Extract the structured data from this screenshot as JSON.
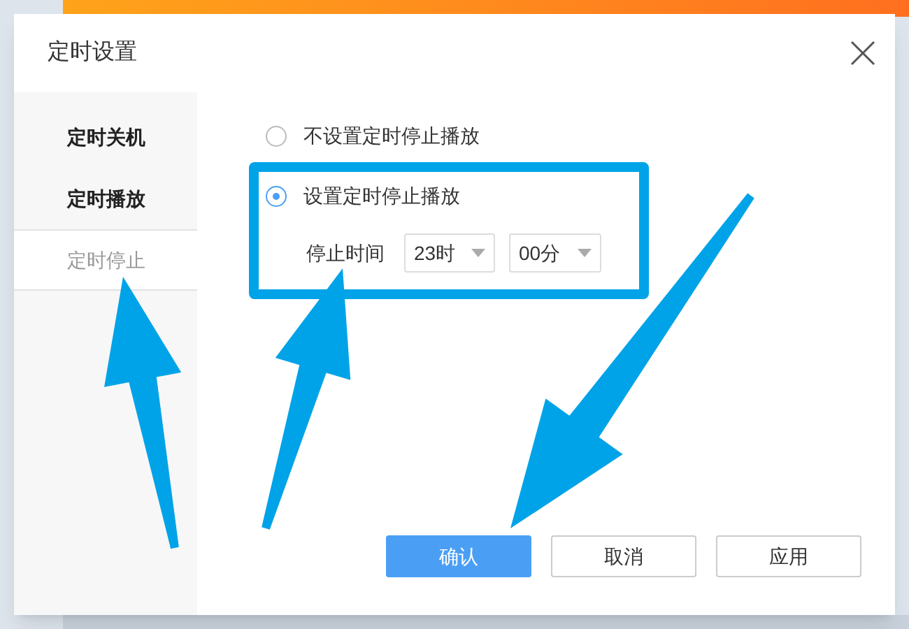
{
  "window": {
    "title": "定时设置"
  },
  "sidebar": {
    "items": [
      {
        "label": "定时关机",
        "selected": false
      },
      {
        "label": "定时播放",
        "selected": false
      },
      {
        "label": "定时停止",
        "selected": true
      }
    ]
  },
  "options": [
    {
      "label": "不设置定时停止播放",
      "selected": false
    },
    {
      "label": "设置定时停止播放",
      "selected": true
    }
  ],
  "stop_time": {
    "label": "停止时间",
    "hour": "23时",
    "minute": "00分"
  },
  "buttons": [
    {
      "label": "确认",
      "kind": "primary"
    },
    {
      "label": "取消",
      "kind": "default"
    },
    {
      "label": "应用",
      "kind": "default"
    }
  ]
}
